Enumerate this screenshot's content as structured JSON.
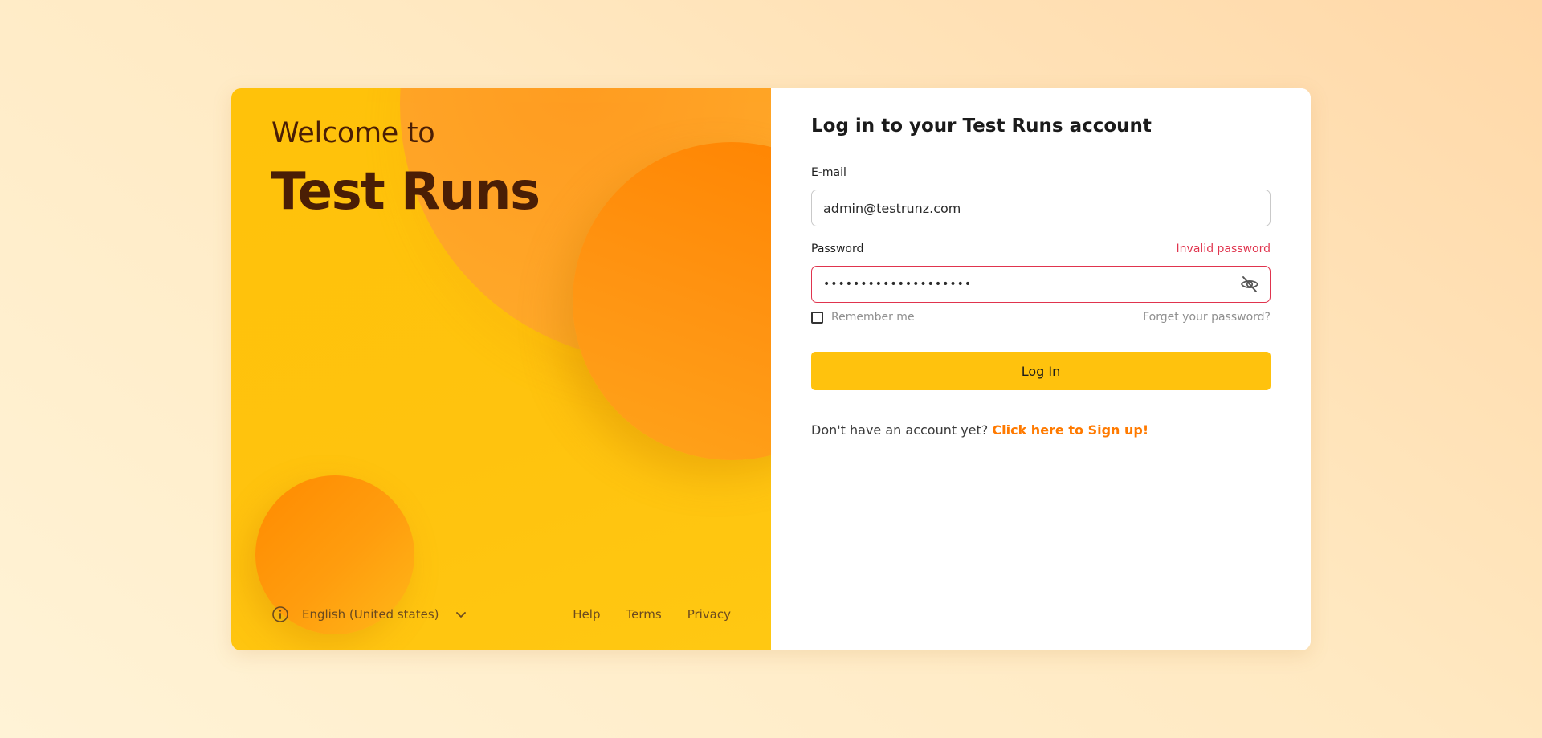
{
  "hero": {
    "welcome_line": "Welcome to",
    "app_name": "Test Runs",
    "language": {
      "icon": "info-icon",
      "selected": "English (United states)",
      "dropdown_icon": "chevron-down-icon"
    },
    "footer_links": [
      "Help",
      "Terms",
      "Privacy"
    ]
  },
  "form": {
    "title": "Log in to your Test Runs account",
    "email": {
      "label": "E-mail",
      "value": "admin@testrunz.com"
    },
    "password": {
      "label": "Password",
      "error": "Invalid password",
      "masked_value": "••••••••••••••••••••",
      "visibility_icon": "eye-off-icon"
    },
    "remember_label": "Remember me",
    "remember_checked": false,
    "forgot_label": "Forget your password?",
    "login_label": "Log In",
    "signup_prompt": "Don't have an account yet?",
    "signup_link": "Click here to Sign up!"
  },
  "colors": {
    "brand_yellow": "#ffc20d",
    "accent_orange": "#ff7a00",
    "error_red": "#e0344e",
    "hero_text": "#4a1e05"
  }
}
